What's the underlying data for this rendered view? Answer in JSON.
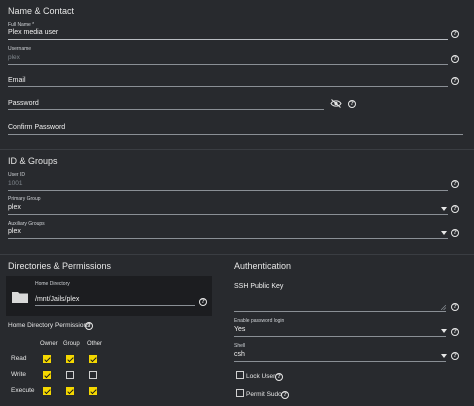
{
  "name_contact": {
    "title": "Name & Contact",
    "full_name_label": "Full Name *",
    "full_name_value": "Plex media user",
    "username_label": "Username",
    "username_value": "plex",
    "email_label": "Email",
    "password_label": "Password",
    "confirm_password_label": "Confirm Password"
  },
  "id_groups": {
    "title": "ID & Groups",
    "user_id_label": "User ID",
    "user_id_value": "1001",
    "primary_group_label": "Primary Group",
    "primary_group_value": "plex",
    "aux_groups_label": "Auxiliary Groups",
    "aux_groups_value": "plex"
  },
  "directories": {
    "title": "Directories & Permissions",
    "home_dir_label": "Home Directory",
    "home_dir_value": "/mnt/Jails/plex",
    "perms_label": "Home Directory Permissions",
    "columns": [
      "Owner",
      "Group",
      "Other"
    ],
    "rows": [
      {
        "label": "Read",
        "values": [
          true,
          true,
          true
        ]
      },
      {
        "label": "Write",
        "values": [
          true,
          false,
          false
        ]
      },
      {
        "label": "Execute",
        "values": [
          true,
          true,
          true
        ]
      }
    ]
  },
  "authentication": {
    "title": "Authentication",
    "ssh_key_label": "SSH Public Key",
    "enable_password_label": "Enable password login",
    "enable_password_value": "Yes",
    "shell_label": "Shell",
    "shell_value": "csh",
    "lock_user_label": "Lock User",
    "permit_sudo_label": "Permit Sudo"
  },
  "icons": {
    "help": "help-circle-icon",
    "eye": "eye-off-icon",
    "folder": "folder-icon",
    "caret": "caret-down-icon"
  },
  "colors": {
    "background": "#282a2e",
    "accent": "#f5d800",
    "panel": "#1c1d20"
  }
}
